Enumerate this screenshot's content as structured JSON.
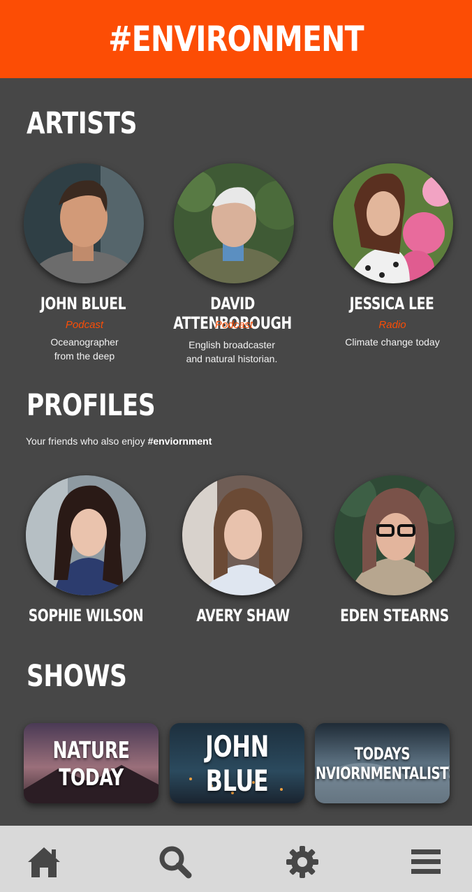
{
  "header": {
    "title": "#ENVIRONMENT"
  },
  "artists": {
    "title": "ARTISTS",
    "items": [
      {
        "name": "JOHN BLUEL",
        "role": "Podcast",
        "desc": [
          "Oceanographer",
          "from the deep"
        ]
      },
      {
        "name": "DAVID ATTENBOROUGH",
        "role": "Podcast",
        "desc": [
          "English broadcaster",
          "and natural historian."
        ]
      },
      {
        "name": "JESSICA LEE",
        "role": "Radio",
        "desc": [
          "Climate change today"
        ]
      }
    ]
  },
  "profiles": {
    "title": "PROFILES",
    "subtitle_prefix": "Your friends who also enjoy ",
    "subtitle_tag": "#enviornment",
    "items": [
      {
        "name": "SOPHIE WILSON"
      },
      {
        "name": "AVERY SHAW"
      },
      {
        "name": "EDEN STEARNS"
      }
    ]
  },
  "shows": {
    "title": "SHOWS",
    "items": [
      {
        "label": "NATURE TODAY"
      },
      {
        "label": "JOHN BLUE"
      },
      {
        "label_lines": [
          "TODAYS",
          "ENVIORNMENTALISTS"
        ]
      }
    ]
  },
  "nav": {
    "items": [
      {
        "icon": "home-icon"
      },
      {
        "icon": "search-icon"
      },
      {
        "icon": "gear-icon"
      },
      {
        "icon": "menu-icon"
      }
    ]
  },
  "colors": {
    "accent": "#fc4d05",
    "background": "#474747",
    "navbar": "#d9d9d9",
    "icon": "#474747"
  }
}
